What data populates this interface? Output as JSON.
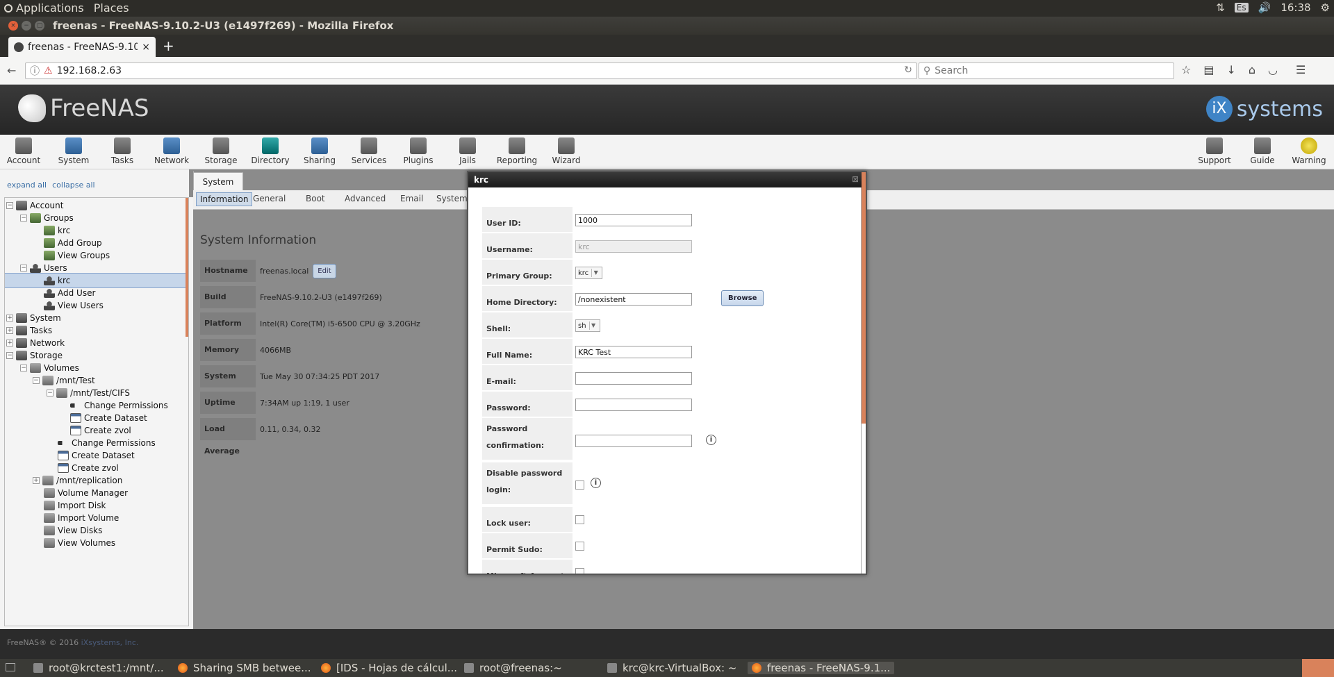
{
  "desktop": {
    "menu_applications": "Applications",
    "menu_places": "Places",
    "keyboard": "Es",
    "clock": "16:38"
  },
  "window": {
    "title": "freenas - FreeNAS-9.10.2-U3 (e1497f269) - Mozilla Firefox"
  },
  "browser": {
    "tab_title": "freenas - FreeNAS-9.10",
    "url": "192.168.2.63",
    "search_placeholder": "Search"
  },
  "freenas": {
    "logo_text": "FreeNAS",
    "ix_text": "systems",
    "ix_mark": "iX",
    "toolbar": [
      {
        "label": "Account",
        "icon": "account-icon"
      },
      {
        "label": "System",
        "icon": "system-icon"
      },
      {
        "label": "Tasks",
        "icon": "tasks-icon"
      },
      {
        "label": "Network",
        "icon": "network-icon"
      },
      {
        "label": "Storage",
        "icon": "storage-icon"
      },
      {
        "label": "Directory",
        "icon": "directory-icon"
      },
      {
        "label": "Sharing",
        "icon": "sharing-icon"
      },
      {
        "label": "Services",
        "icon": "services-icon"
      },
      {
        "label": "Plugins",
        "icon": "plugins-icon"
      },
      {
        "label": "Jails",
        "icon": "jails-icon"
      },
      {
        "label": "Reporting",
        "icon": "reporting-icon"
      },
      {
        "label": "Wizard",
        "icon": "wizard-icon"
      }
    ],
    "toolbar_right": [
      {
        "label": "Support",
        "icon": "support-icon"
      },
      {
        "label": "Guide",
        "icon": "guide-icon"
      },
      {
        "label": "Warning",
        "icon": "warning-icon"
      }
    ],
    "expand_all": "expand all",
    "collapse_all": "collapse all",
    "tree": [
      {
        "label": "Account",
        "exp": "−"
      },
      {
        "label": "Groups",
        "exp": "−"
      },
      {
        "label": "krc"
      },
      {
        "label": "Add Group"
      },
      {
        "label": "View Groups"
      },
      {
        "label": "Users",
        "exp": "−"
      },
      {
        "label": "krc"
      },
      {
        "label": "Add User"
      },
      {
        "label": "View Users"
      },
      {
        "label": "System",
        "exp": "+"
      },
      {
        "label": "Tasks",
        "exp": "+"
      },
      {
        "label": "Network",
        "exp": "+"
      },
      {
        "label": "Storage",
        "exp": "−"
      },
      {
        "label": "Volumes",
        "exp": "−"
      },
      {
        "label": "/mnt/Test",
        "exp": "−"
      },
      {
        "label": "/mnt/Test/CIFS",
        "exp": "−"
      },
      {
        "label": "Change Permissions"
      },
      {
        "label": "Create Dataset"
      },
      {
        "label": "Create zvol"
      },
      {
        "label": "Change Permissions"
      },
      {
        "label": "Create Dataset"
      },
      {
        "label": "Create zvol"
      },
      {
        "label": "/mnt/replication",
        "exp": "+"
      },
      {
        "label": "Volume Manager"
      },
      {
        "label": "Import Disk"
      },
      {
        "label": "Import Volume"
      },
      {
        "label": "View Disks"
      },
      {
        "label": "View Volumes"
      }
    ],
    "main_tab": "System",
    "subtabs": [
      "Information",
      "General",
      "Boot",
      "Advanced",
      "Email",
      "System D"
    ],
    "sysinfo_title": "System Information",
    "sysinfo": [
      {
        "k": "Hostname",
        "v": "freenas.local"
      },
      {
        "k": "Build",
        "v": "FreeNAS-9.10.2-U3 (e1497f269)"
      },
      {
        "k": "Platform",
        "v": "Intel(R) Core(TM) i5-6500 CPU @ 3.20GHz"
      },
      {
        "k": "Memory",
        "v": "4066MB"
      },
      {
        "k": "System Time",
        "v": "Tue May 30 07:34:25 PDT 2017"
      },
      {
        "k": "Uptime",
        "v": "7:34AM up 1:19, 1 user"
      },
      {
        "k": "Load Average",
        "v": "0.11, 0.34, 0.32"
      }
    ],
    "edit_label": "Edit",
    "footer": "FreeNAS® © 2016",
    "footer_link": "iXsystems, Inc."
  },
  "dialog": {
    "title": "krc",
    "user_id_label": "User ID:",
    "user_id": "1000",
    "username_label": "Username:",
    "username": "krc",
    "primary_group_label": "Primary Group:",
    "primary_group": "krc",
    "home_label": "Home Directory:",
    "home": "/nonexistent",
    "browse": "Browse",
    "shell_label": "Shell:",
    "shell": "sh",
    "fullname_label": "Full Name:",
    "fullname": "KRC Test",
    "email_label": "E-mail:",
    "password_label": "Password:",
    "password_confirm_label": "Password confirmation:",
    "disable_pw_label": "Disable password login:",
    "lock_label": "Lock user:",
    "sudo_label": "Permit Sudo:",
    "ms_label": "Microsoft Account:"
  },
  "taskbar": [
    {
      "label": "root@krctest1:/mnt/..."
    },
    {
      "label": "Sharing SMB betwee..."
    },
    {
      "label": "[IDS - Hojas de cálcul..."
    },
    {
      "label": "root@freenas:~"
    },
    {
      "label": "krc@krc-VirtualBox: ~"
    },
    {
      "label": "freenas - FreeNAS-9.1..."
    }
  ]
}
